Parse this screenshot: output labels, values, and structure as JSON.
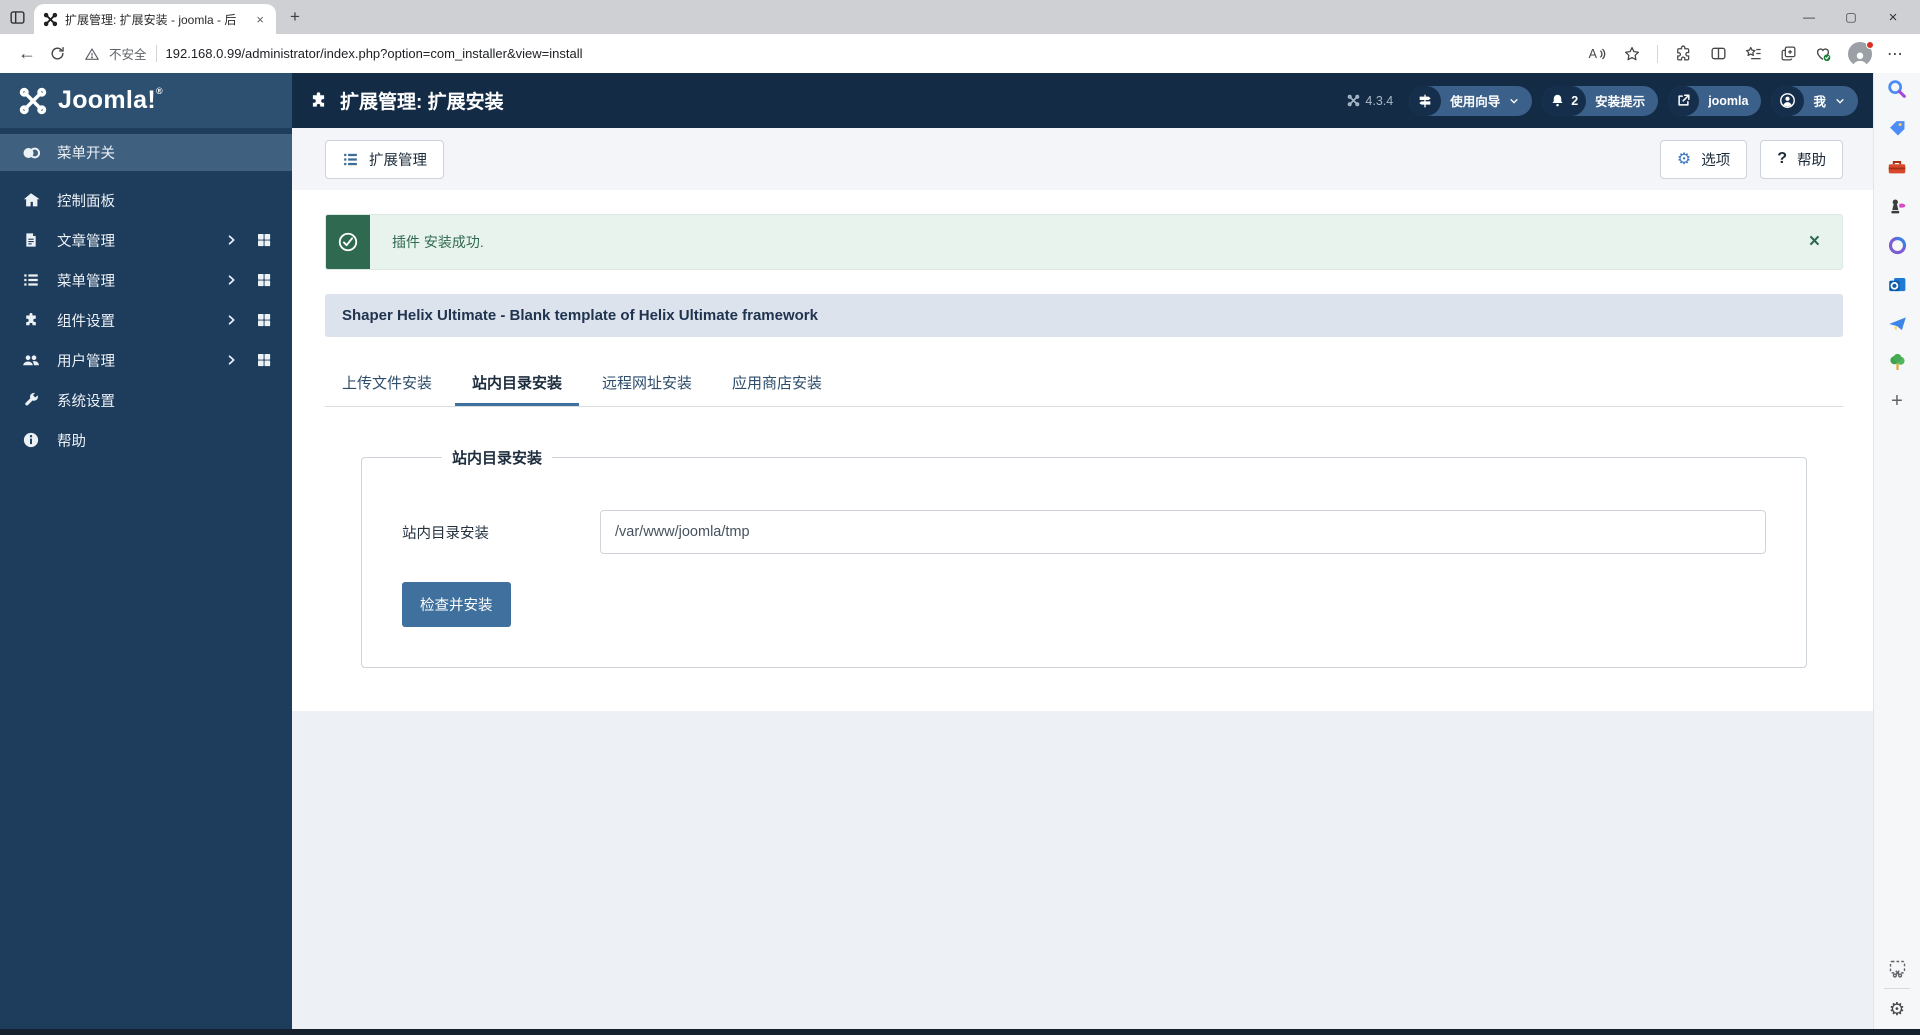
{
  "browser": {
    "tab_title": "扩展管理: 扩展安装 - joomla - 后",
    "tab_close": "×",
    "new_tab": "+",
    "window_controls": {
      "minimize": "—",
      "maximize": "▢",
      "close": "×"
    },
    "back_glyph": "←",
    "security_label": "不安全",
    "url": "192.168.0.99/administrator/index.php?option=com_installer&view=install",
    "menu_dots": "⋯",
    "toolbar_icon_names": [
      "back-icon",
      "refresh-icon",
      "warning-icon",
      "read-aloud-icon",
      "favorite-star-icon",
      "extensions-icon",
      "split-screen-icon",
      "favorites-bar-icon",
      "collections-icon",
      "browser-essentials-icon",
      "profile-avatar",
      "more-menu-icon"
    ]
  },
  "edge_sidebar": {
    "icon_names": [
      "search-icon",
      "shopping-icon",
      "toolbox-icon",
      "games-icon",
      "m365-icon",
      "outlook-icon",
      "drop-icon",
      "tree-icon",
      "add-icon",
      "screenshot-icon",
      "settings-gear-icon"
    ],
    "add_glyph": "+",
    "gear_glyph": "⚙"
  },
  "admin": {
    "logo_text": "Joomla!",
    "logo_reg": "®",
    "version": "4.3.4",
    "page_title": "扩展管理: 扩展安装",
    "pills": {
      "guide": {
        "label": "使用向导"
      },
      "notices": {
        "badge": "2",
        "label": "安装提示"
      },
      "site": {
        "label": "joomla"
      },
      "me": {
        "label": "我"
      }
    },
    "sidebar": {
      "items": [
        {
          "label": "菜单开关"
        },
        {
          "label": "控制面板"
        },
        {
          "label": "文章管理"
        },
        {
          "label": "菜单管理"
        },
        {
          "label": "组件设置"
        },
        {
          "label": "用户管理"
        },
        {
          "label": "系统设置"
        },
        {
          "label": "帮助"
        }
      ]
    },
    "toolbar": {
      "extensions": "扩展管理",
      "options": "选项",
      "options_gear_glyph": "⚙",
      "help": "帮助",
      "help_glyph": "?"
    },
    "alert": {
      "message": "插件 安装成功.",
      "close": "×"
    },
    "template_title": "Shaper Helix Ultimate - Blank template of Helix Ultimate framework",
    "tabs": [
      {
        "label": "上传文件安装"
      },
      {
        "label": "站内目录安装"
      },
      {
        "label": "远程网址安装"
      },
      {
        "label": "应用商店安装"
      }
    ],
    "form": {
      "legend": "站内目录安装",
      "label": "站内目录安装",
      "value": "/var/www/joomla/tmp",
      "button": "检查并安装"
    }
  },
  "colors": {
    "header": "#132b45",
    "logo_panel": "#2d4f70",
    "sidebar": "#1e3c5c",
    "sidebar_active": "#3f607f",
    "pill": "#3b608a",
    "pill_dark": "#142e4b",
    "accent": "#40719e",
    "alert_green": "#2f6a50",
    "alert_bg": "#e9f3ee",
    "title_bar_bg": "#dce3ed"
  }
}
